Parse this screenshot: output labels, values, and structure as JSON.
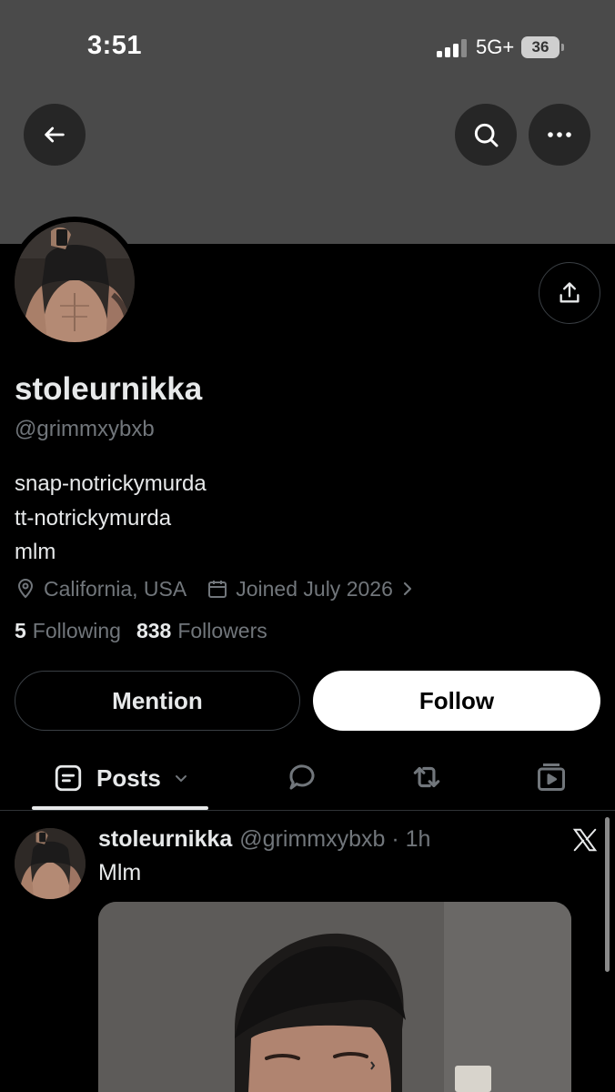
{
  "status_bar": {
    "time": "3:51",
    "network": "5G+",
    "battery": "36"
  },
  "header": {
    "back_icon": "arrow-left-icon",
    "search_icon": "search-icon",
    "more_icon": "more-horizontal-icon"
  },
  "profile": {
    "display_name": "stoleurnikka",
    "handle": "@grimmxybxb",
    "bio_lines": [
      "snap-notrickymurda",
      "tt-notrickymurda",
      "mlm"
    ],
    "location": "California, USA",
    "joined": "Joined July 2026",
    "following_count": "5",
    "following_label": "Following",
    "followers_count": "838",
    "followers_label": "Followers"
  },
  "actions": {
    "mention_label": "Mention",
    "follow_label": "Follow"
  },
  "tabs": {
    "posts_label": "Posts",
    "icons": [
      "posts-icon",
      "replies-icon",
      "reposts-icon",
      "media-icon"
    ]
  },
  "post": {
    "author_name": "stoleurnikka",
    "author_meta": "@grimmxybxb · 1h",
    "text": "Mlm"
  },
  "colors": {
    "background": "#000000",
    "banner": "#4a4a4a",
    "primary_text": "#e7e9ea",
    "secondary_text": "#71767b",
    "border": "#2f3336"
  }
}
